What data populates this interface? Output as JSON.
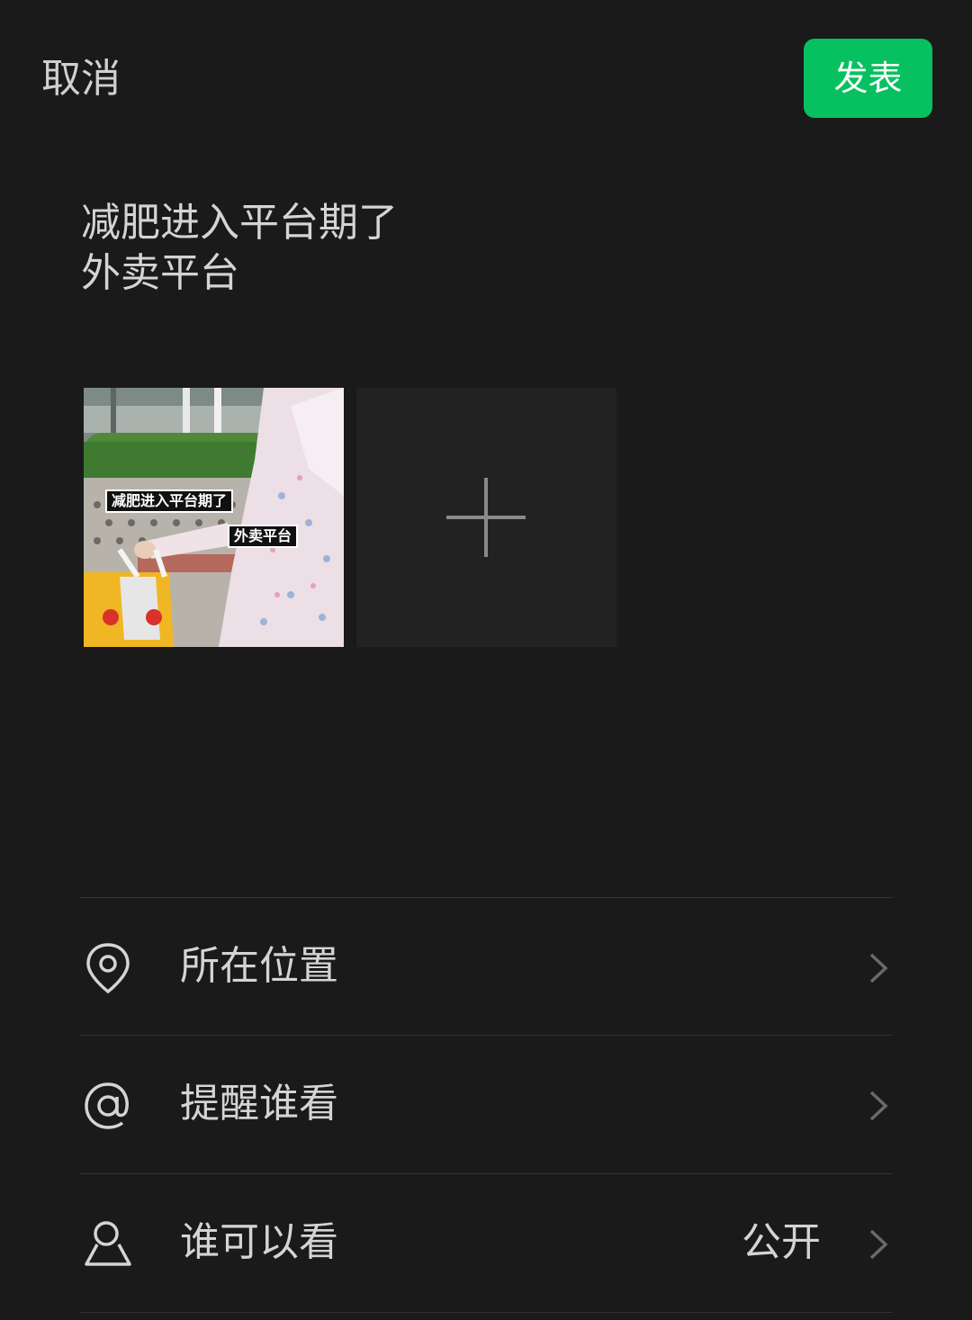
{
  "header": {
    "cancel_label": "取消",
    "publish_label": "发表"
  },
  "post": {
    "text": "减肥进入平台期了\n外卖平台"
  },
  "media": {
    "thumbnail": {
      "caption_line1": "减肥进入平台期了",
      "caption_line2": "外卖平台"
    },
    "add_icon": "plus-icon"
  },
  "options": [
    {
      "icon": "location-icon",
      "label": "所在位置",
      "value": ""
    },
    {
      "icon": "at-icon",
      "label": "提醒谁看",
      "value": ""
    },
    {
      "icon": "person-icon",
      "label": "谁可以看",
      "value": "公开"
    }
  ],
  "colors": {
    "background": "#1a1a1a",
    "accent": "#07c160"
  }
}
